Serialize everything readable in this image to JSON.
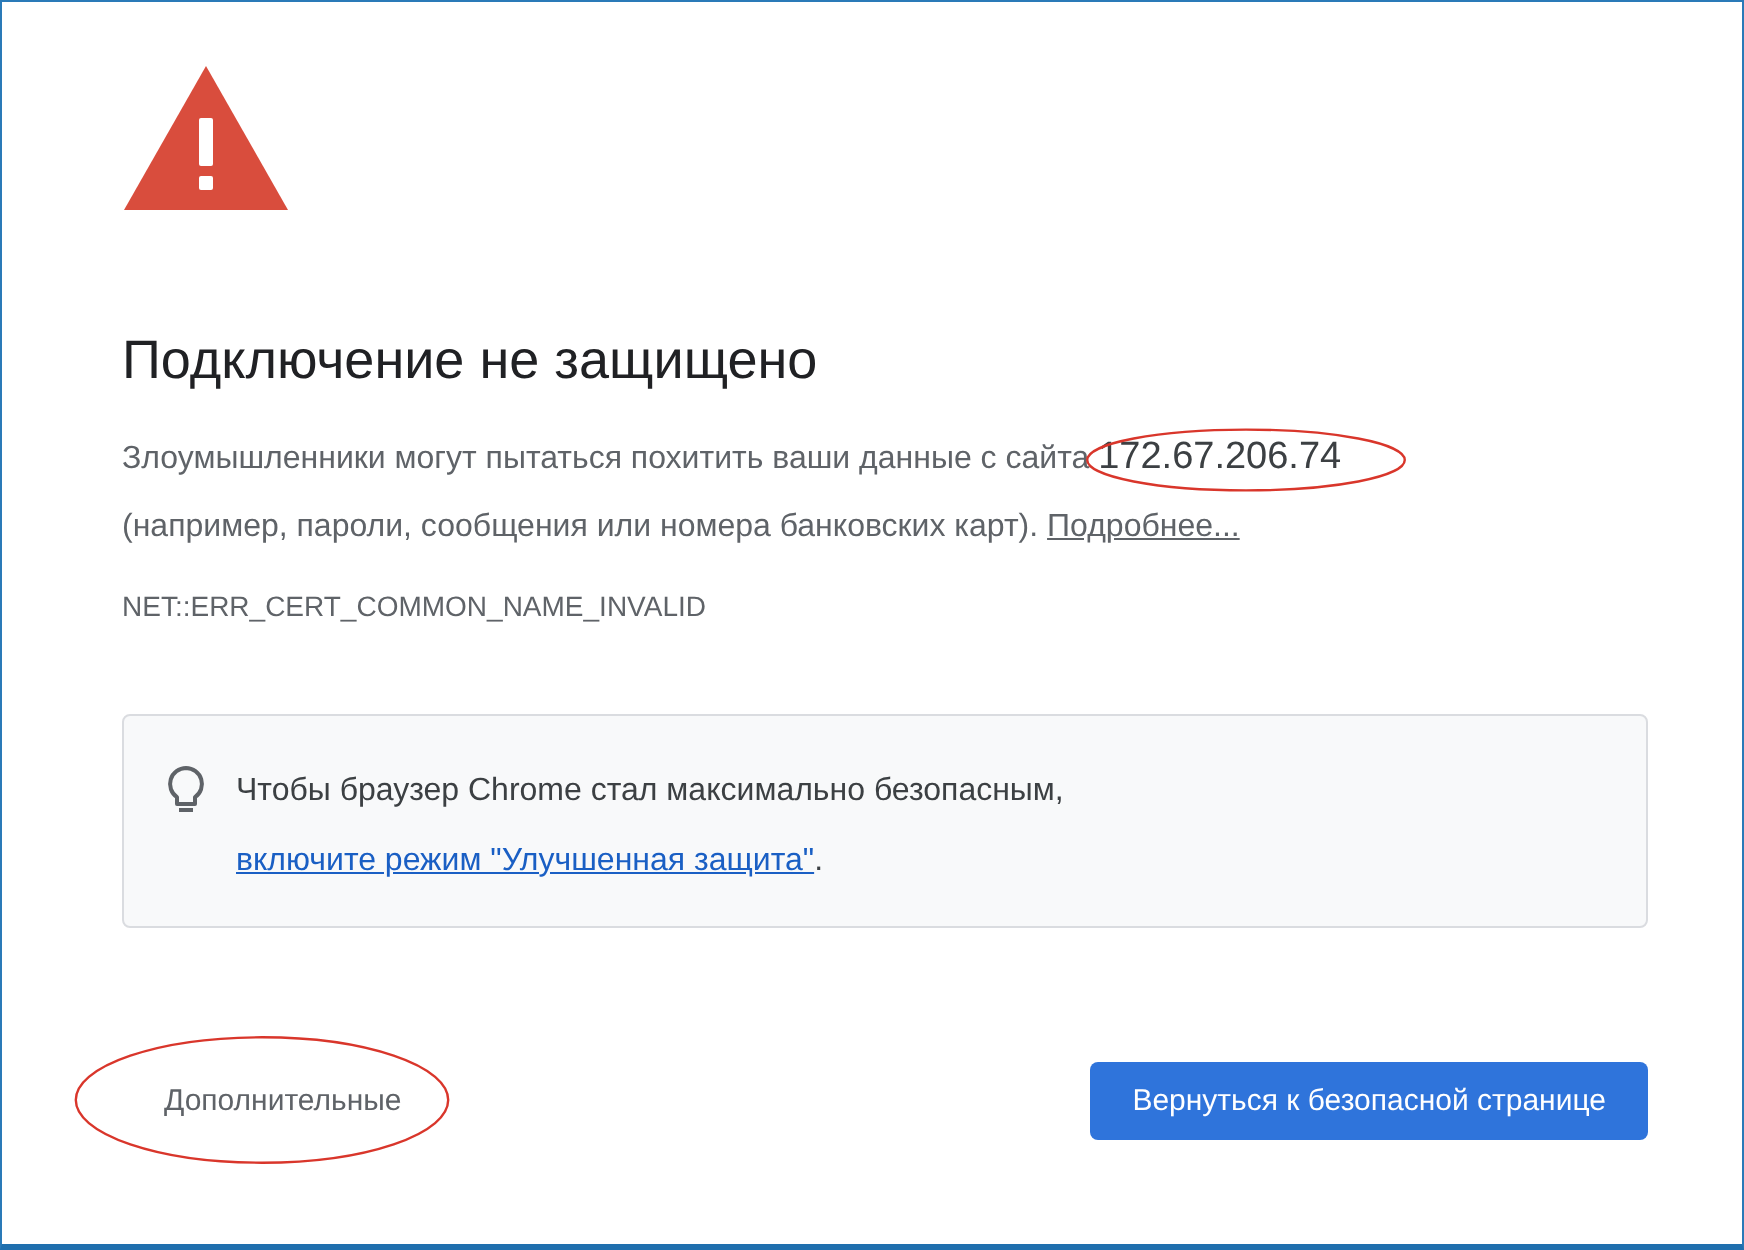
{
  "title": "Подключение не защищено",
  "message": {
    "text": "Злоумышленники могут пытаться похитить ваши данные с сайта",
    "host": "172.67.206.74",
    "host_circled": true,
    "details": "(например, пароли, сообщения или номера банковских карт).",
    "link": "Подробнее..."
  },
  "error_code": "NET::ERR_CERT_COMMON_NAME_INVALID",
  "tip": {
    "text": "Чтобы браузер Chrome стал максимально безопасным,",
    "link": "включите режим \"Улучшенная защита\"",
    "end": "."
  },
  "buttons": [
    {
      "label": "Дополнительные",
      "kind": "secondary",
      "circled": true
    },
    {
      "label": "Вернуться к безопасной странице",
      "kind": "primary",
      "circled": false
    }
  ]
}
